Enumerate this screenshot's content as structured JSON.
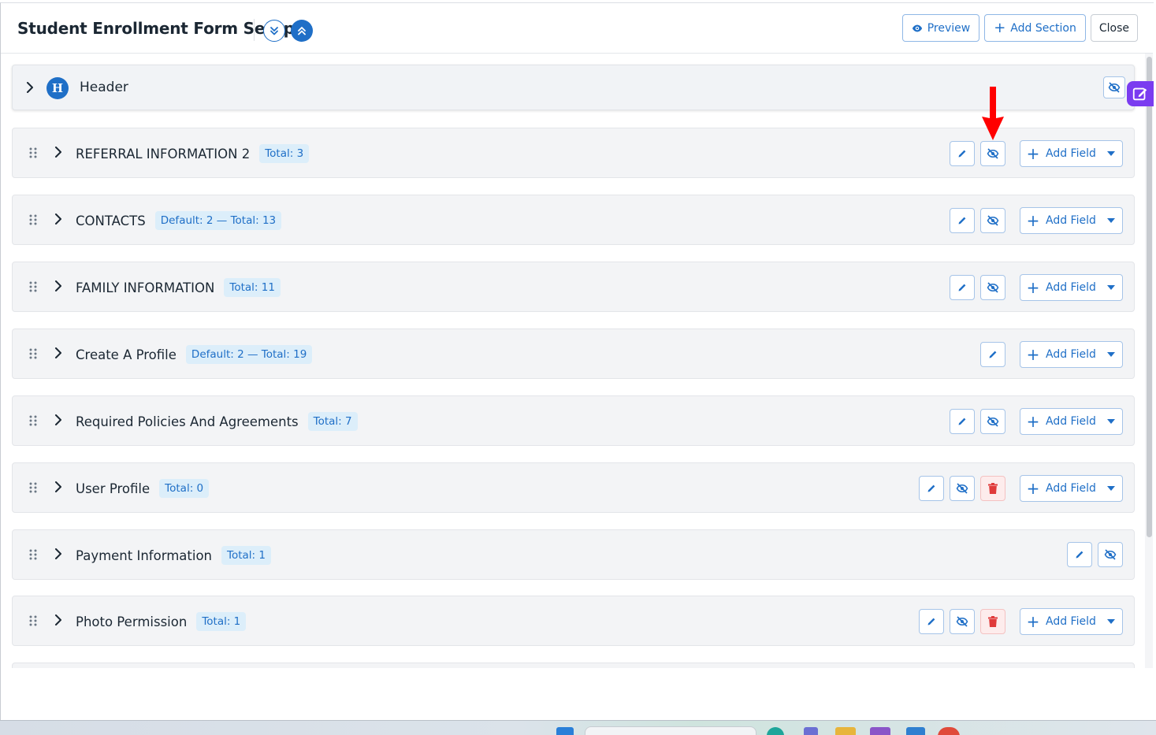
{
  "app": {
    "title": "Student Enrollment Form Setup",
    "actions": {
      "preview": "Preview",
      "add_section": "Add Section",
      "close": "Close"
    }
  },
  "header_section": {
    "avatar_letter": "H",
    "label": "Header"
  },
  "add_field_label": "Add Field",
  "sections": [
    {
      "title": "REFERRAL INFORMATION 2",
      "badge": "Total: 3",
      "buttons": [
        "edit",
        "hide"
      ],
      "add_field": true
    },
    {
      "title": "CONTACTS",
      "badge": "Default: 2 — Total: 13",
      "buttons": [
        "edit",
        "hide"
      ],
      "add_field": true
    },
    {
      "title": "FAMILY INFORMATION",
      "badge": "Total: 11",
      "buttons": [
        "edit",
        "hide"
      ],
      "add_field": true
    },
    {
      "title": "Create A Profile",
      "badge": "Default: 2 — Total: 19",
      "buttons": [
        "edit"
      ],
      "add_field": true
    },
    {
      "title": "Required Policies And Agreements",
      "badge": "Total: 7",
      "buttons": [
        "edit",
        "hide"
      ],
      "add_field": true
    },
    {
      "title": "User Profile",
      "badge": "Total: 0",
      "buttons": [
        "edit",
        "hide",
        "delete"
      ],
      "add_field": true
    },
    {
      "title": "Payment Information",
      "badge": "Total: 1",
      "buttons": [
        "edit",
        "hide"
      ],
      "add_field": false
    },
    {
      "title": "Photo Permission",
      "badge": "Total: 1",
      "buttons": [
        "edit",
        "hide",
        "delete"
      ],
      "add_field": true
    }
  ],
  "colors": {
    "primary": "#1f6fc7",
    "badge_bg": "#dceefa",
    "danger": "#e03a3a",
    "annotation_arrow": "#ff0000",
    "widget": "#7a3cf0"
  }
}
